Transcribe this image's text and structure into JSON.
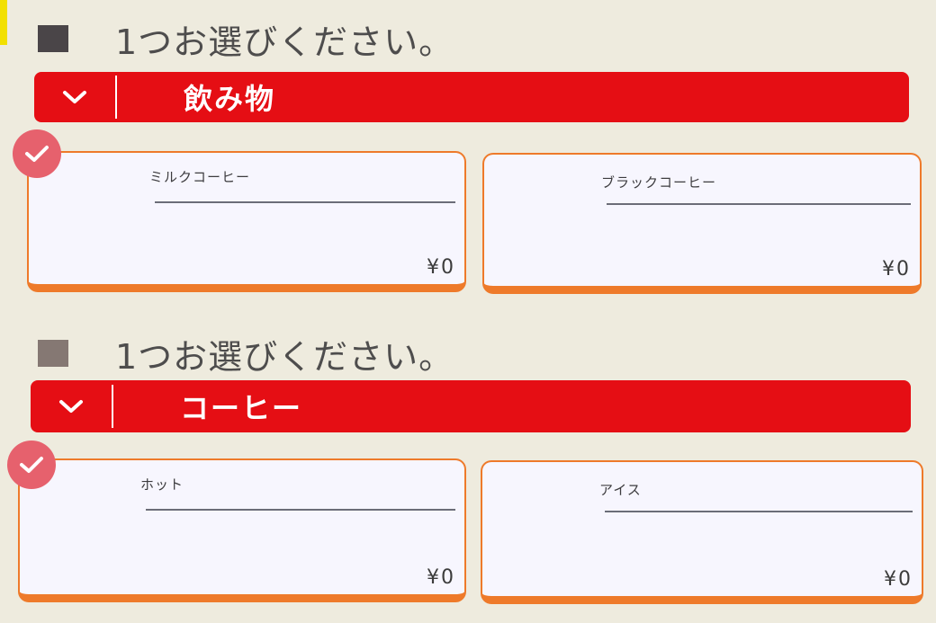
{
  "groups": [
    {
      "prompt": "1つお選びください。",
      "category": "飲み物",
      "options": [
        {
          "name": "ミルクコーヒー",
          "price": "¥0",
          "selected": true
        },
        {
          "name": "ブラックコーヒー",
          "price": "¥0",
          "selected": false
        }
      ]
    },
    {
      "prompt": "1つお選びください。",
      "category": "コーヒー",
      "options": [
        {
          "name": "ホット",
          "price": "¥0",
          "selected": true
        },
        {
          "name": "アイス",
          "price": "¥0",
          "selected": false
        }
      ]
    }
  ],
  "colors": {
    "background": "#eeebde",
    "category_bar": "#e50e14",
    "card_border": "#ee7a2a",
    "check_badge": "#e6616d"
  },
  "icons": {
    "collapse": "chevron-down-icon",
    "selected": "check-icon"
  }
}
